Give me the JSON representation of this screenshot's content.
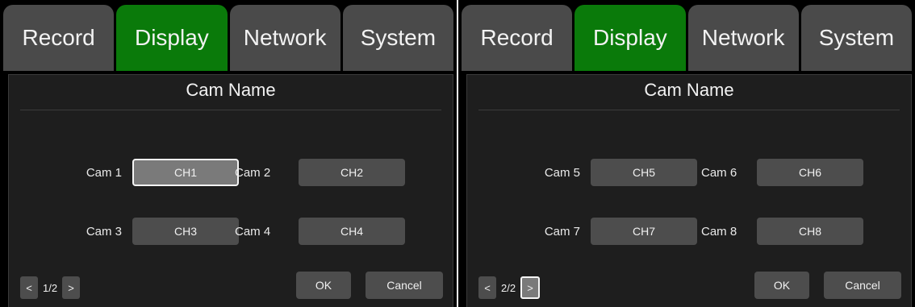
{
  "screens": [
    {
      "tabs": [
        {
          "label": "Record"
        },
        {
          "label": "Display"
        },
        {
          "label": "Network"
        },
        {
          "label": "System"
        }
      ],
      "active_tab": "Display",
      "panel_title": "Cam Name",
      "cameras": [
        {
          "label": "Cam 1",
          "value": "CH1"
        },
        {
          "label": "Cam 2",
          "value": "CH2"
        },
        {
          "label": "Cam 3",
          "value": "CH3"
        },
        {
          "label": "Cam 4",
          "value": "CH4"
        }
      ],
      "prev_label": "<",
      "page_indicator": "1/2",
      "next_label": ">",
      "ok_label": "OK",
      "cancel_label": "Cancel"
    },
    {
      "tabs": [
        {
          "label": "Record"
        },
        {
          "label": "Display"
        },
        {
          "label": "Network"
        },
        {
          "label": "System"
        }
      ],
      "active_tab": "Display",
      "panel_title": "Cam Name",
      "cameras": [
        {
          "label": "Cam 5",
          "value": "CH5"
        },
        {
          "label": "Cam 6",
          "value": "CH6"
        },
        {
          "label": "Cam 7",
          "value": "CH7"
        },
        {
          "label": "Cam 8",
          "value": "CH8"
        }
      ],
      "prev_label": "<",
      "page_indicator": "2/2",
      "next_label": ">",
      "ok_label": "OK",
      "cancel_label": "Cancel"
    }
  ],
  "colors": {
    "active_tab": "#0a7a0a",
    "inactive_tab": "#4a4a4a",
    "panel_bg": "#1e1e1e",
    "field_bg": "#4d4d4d",
    "focused_bg": "#7a7a7a"
  }
}
